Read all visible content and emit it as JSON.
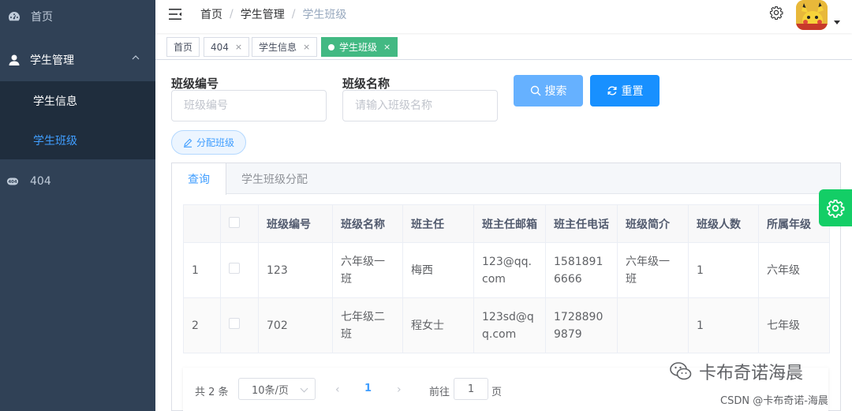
{
  "sidebar": {
    "home": "首页",
    "student_mgmt": "学生管理",
    "student_info": "学生信息",
    "student_class": "学生班级",
    "page_404": "404"
  },
  "header": {
    "breadcrumb": [
      "首页",
      "学生管理",
      "学生班级"
    ],
    "breadcrumb_sep": "/"
  },
  "tags": [
    {
      "label": "首页",
      "closable": false
    },
    {
      "label": "404",
      "closable": true
    },
    {
      "label": "学生信息",
      "closable": true
    },
    {
      "label": "学生班级",
      "closable": true,
      "active": true
    }
  ],
  "tag_close": "×",
  "form": {
    "class_no_label": "班级编号",
    "class_no_placeholder": "班级编号",
    "class_name_label": "班级名称",
    "class_name_placeholder": "请输入班级名称",
    "search": "搜索",
    "reset": "重置",
    "assign": "分配班级"
  },
  "card_tabs": [
    "查询",
    "学生班级分配"
  ],
  "table": {
    "headers": [
      "",
      "",
      "班级编号",
      "班级名称",
      "班主任",
      "班主任邮箱",
      "班主任电话",
      "班级简介",
      "班级人数",
      "所属年级"
    ],
    "rows": [
      [
        "1",
        "",
        "123",
        "六年级一班",
        "梅西",
        "123@qq.com",
        "15818916666",
        "六年级一班",
        "1",
        "六年级"
      ],
      [
        "2",
        "",
        "702",
        "七年级二班",
        "程女士",
        "123sd@qq.com",
        "17288909879",
        "",
        "1",
        "七年级"
      ]
    ]
  },
  "pagination": {
    "total": "共 2 条",
    "page_size": "10条/页",
    "prev": "‹",
    "page": "1",
    "next": "›",
    "goto": "前往",
    "goto_value": "1",
    "unit": "页"
  },
  "watermark": {
    "main": "卡布奇诺海晨",
    "sub": "CSDN @卡布奇诺-海晨"
  },
  "colors": {
    "sidebar_bg": "#304156",
    "submenu_bg": "#1f2d3d",
    "accent": "#409eff",
    "tag_active": "#42b983",
    "settings_fab": "#13ce66"
  }
}
